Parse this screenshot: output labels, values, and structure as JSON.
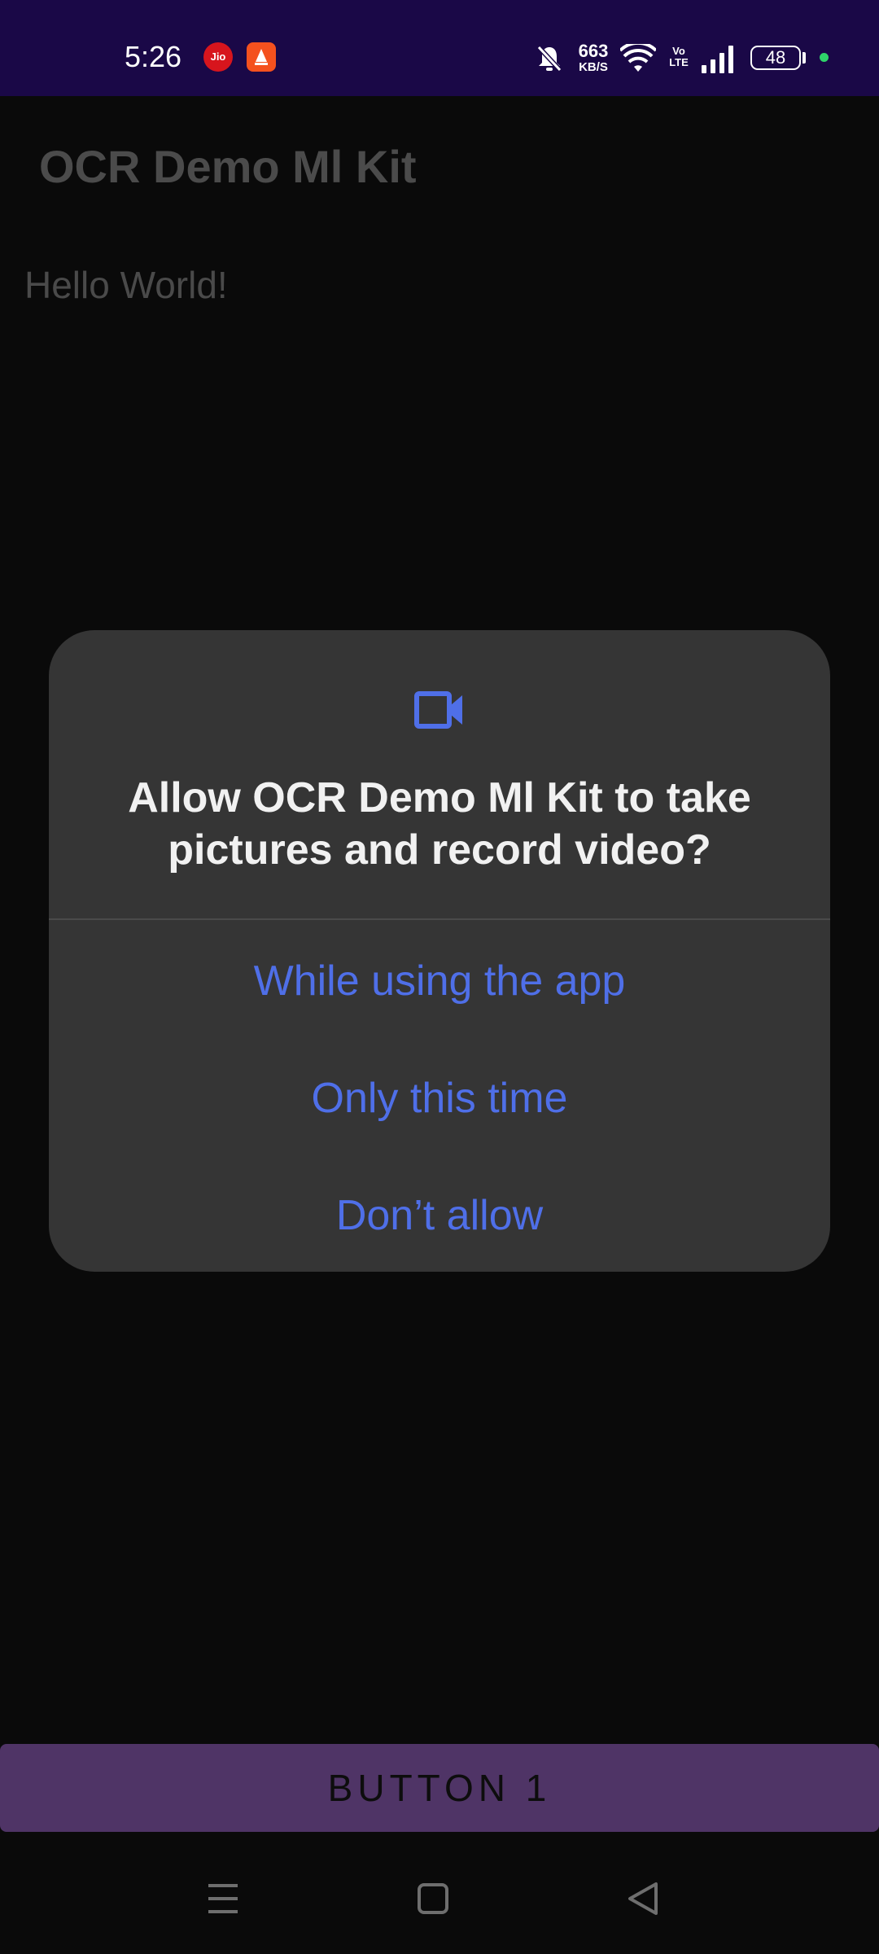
{
  "status_bar": {
    "time": "5:26",
    "jio_label": "Jio",
    "speed_value": "663",
    "speed_unit": "KB/S",
    "volte_label": "Vo LTE",
    "battery_level": "48",
    "colors": {
      "background": "#1a0847",
      "dot": "#2fd46a"
    }
  },
  "app": {
    "title": "OCR Demo Ml Kit",
    "body_text": "Hello World!",
    "button_label": "BUTTON 1"
  },
  "dialog": {
    "icon": "video-camera-icon",
    "title": "Allow OCR Demo Ml Kit to take pictures and record video?",
    "options": [
      {
        "label": "While using the app"
      },
      {
        "label": "Only this time"
      },
      {
        "label": "Don’t allow"
      }
    ],
    "colors": {
      "background": "#353535",
      "accent": "#4f6fe8"
    }
  },
  "nav_bar": {
    "icons": [
      "menu-icon",
      "home-icon",
      "back-icon"
    ]
  }
}
